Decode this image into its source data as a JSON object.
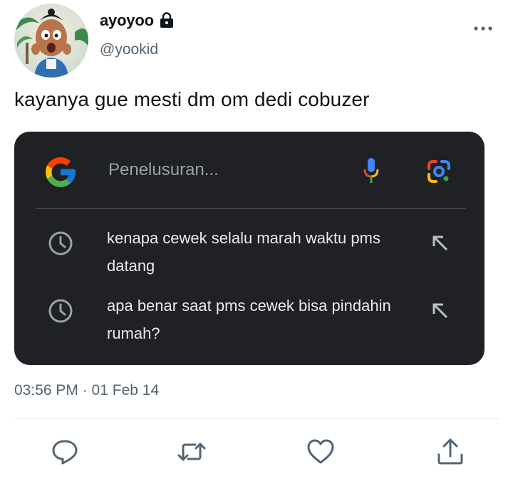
{
  "tweet": {
    "display_name": "ayoyoo",
    "handle": "@yookid",
    "text": "kayanya gue mesti dm om dedi cobuzer",
    "timestamp": "03:56 PM · 01 Feb 14"
  },
  "search_card": {
    "placeholder": "Penelusuran...",
    "history": [
      {
        "text": "kenapa cewek selalu marah waktu pms datang",
        "icon": "clock-icon"
      },
      {
        "text": "apa benar saat pms cewek bisa pindahin rumah?",
        "icon": "clock-icon"
      }
    ],
    "colors": {
      "background": "#202124",
      "text": "#e8eaed",
      "placeholder": "#9aa0a6"
    }
  },
  "icons": {
    "header": [
      "lock-icon",
      "more-icon"
    ],
    "search": [
      "google-logo-icon",
      "mic-icon",
      "lens-icon"
    ],
    "actions": [
      "reply-icon",
      "retweet-icon",
      "like-icon",
      "share-icon"
    ]
  },
  "colors": {
    "text_primary": "#0f1419",
    "text_secondary": "#536471"
  }
}
